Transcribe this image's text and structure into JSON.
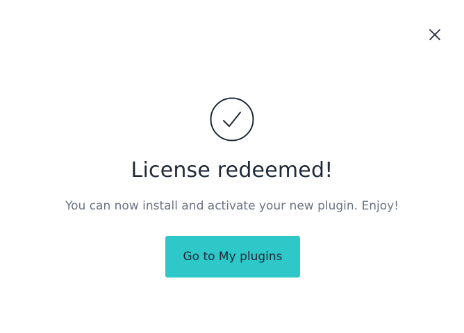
{
  "dialog": {
    "title": "License redeemed!",
    "message": "You can now install and activate your new plugin. Enjoy!",
    "primary_button": "Go to My plugins",
    "close_icon": "close-icon",
    "status_icon": "check-circle-icon"
  },
  "colors": {
    "accent": "#2ec8c8",
    "heading": "#1f2937",
    "body_text": "#6b7280",
    "icon_stroke": "#1f2937"
  }
}
